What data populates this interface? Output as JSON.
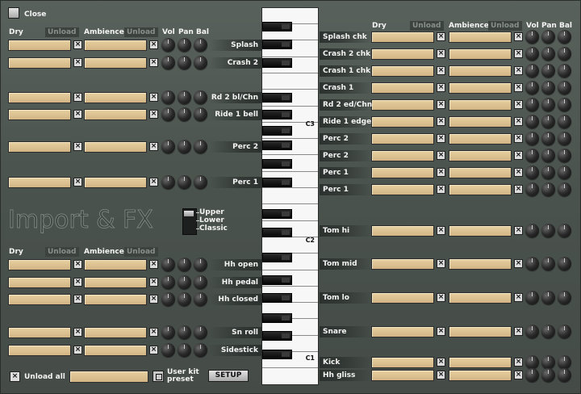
{
  "window": {
    "close_label": "Close"
  },
  "headers": {
    "dry": "Dry",
    "unload": "Unload",
    "ambience": "Ambience",
    "vol": "Vol",
    "pan": "Pan",
    "bal": "Bal"
  },
  "left_top_rows": [
    {
      "name": "Splash"
    },
    {
      "name": "Crash 2"
    },
    {
      "name": "Rd 2 bl/Chn"
    },
    {
      "name": "Ride 1 bell"
    },
    {
      "name": "Perc 2"
    },
    {
      "name": "Perc 1"
    }
  ],
  "left_bottom_rows": [
    {
      "name": "Hh open"
    },
    {
      "name": "Hh pedal"
    },
    {
      "name": "Hh closed"
    },
    {
      "name": "Sn roll"
    },
    {
      "name": "Sidestick"
    }
  ],
  "right_rows": [
    {
      "name": "Splash chk"
    },
    {
      "name": "Crash 2 chk"
    },
    {
      "name": "Crash 1 chk"
    },
    {
      "name": "Crash 1"
    },
    {
      "name": "Rd 2 ed/Chn"
    },
    {
      "name": "Ride 1 edge"
    },
    {
      "name": "Perc 2"
    },
    {
      "name": "Perc 2"
    },
    {
      "name": "Perc 1"
    },
    {
      "name": "Perc 1"
    },
    {
      "name": "Tom hi"
    },
    {
      "name": "Tom mid"
    },
    {
      "name": "Tom lo"
    },
    {
      "name": "Snare"
    },
    {
      "name": "Kick"
    },
    {
      "name": "Hh gliss"
    }
  ],
  "logo_text": "Import & FX",
  "layer_switch": {
    "options": [
      "Upper",
      "Lower",
      "Classic"
    ],
    "selected": "Upper"
  },
  "keyboard": {
    "octave_labels": [
      "C3",
      "C2",
      "C1"
    ]
  },
  "footer": {
    "unload_all_label": "Unload all",
    "preset_input_value": "",
    "user_kit_preset_label": "User kit preset",
    "setup_label": "SETUP"
  }
}
